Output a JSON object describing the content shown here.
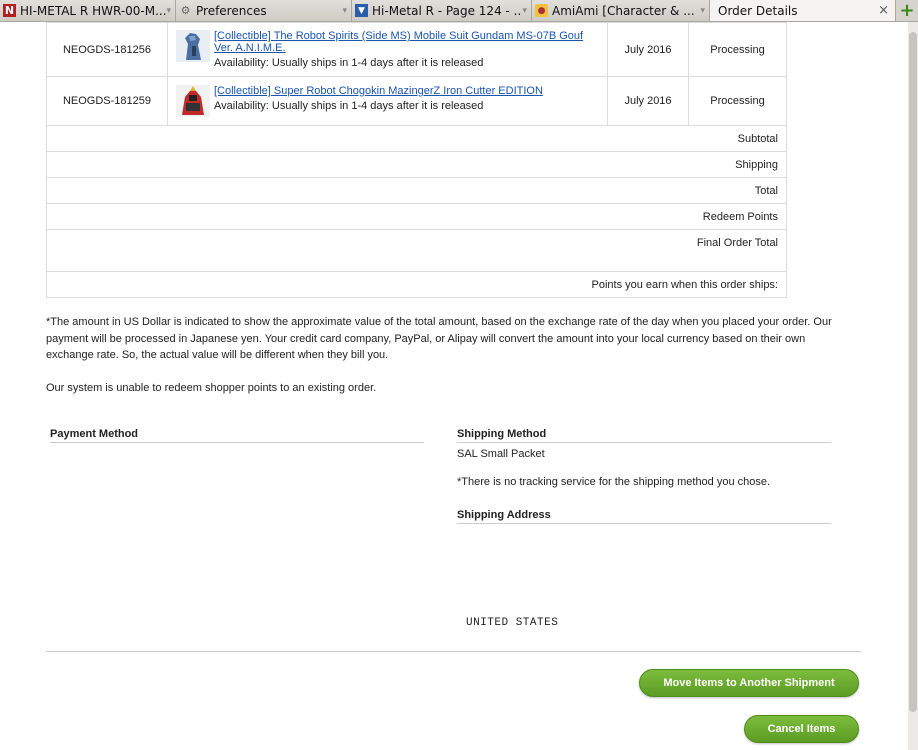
{
  "browser": {
    "tabs": [
      {
        "title": "HI-METAL R HWR-00-M...",
        "icon": "site-favicon"
      },
      {
        "title": "Preferences",
        "icon": "gear-icon"
      },
      {
        "title": "Hi-Metal R - Page 124 - ...",
        "icon": "site-favicon"
      },
      {
        "title": "AmiAmi [Character & ...",
        "icon": "site-favicon"
      },
      {
        "title": "Order Details",
        "icon": "",
        "active": true
      }
    ],
    "new_tab_label": "+"
  },
  "order_items": [
    {
      "code": "NEOGDS-181256",
      "name_line1": "[Collectible] The Robot Spirits (Side MS) Mobile Suit Gundam MS-07B Gouf",
      "name_line2": "Ver. A.N.I.M.E.",
      "availability": "Availability: Usually ships in 1-4 days after it is released",
      "release": "July 2016",
      "status": "Processing"
    },
    {
      "code": "NEOGDS-181259",
      "name_line1": "[Collectible] Super Robot Chogokin MazingerZ Iron Cutter EDITION",
      "name_line2": "",
      "availability": "Availability: Usually ships in 1-4 days after it is released",
      "release": "July 2016",
      "status": "Processing"
    }
  ],
  "summary": {
    "subtotal": "Subtotal",
    "shipping": "Shipping",
    "total": "Total",
    "redeem": "Redeem Points",
    "final": "Final Order Total",
    "points": "Points you earn when this order ships:"
  },
  "notes": {
    "currency": "*The amount in US Dollar is indicated to show the approximate value of the total amount, based on the exchange rate of the day when you placed your order. Our payment will be processed in Japanese yen. Your credit card company, PayPal, or Alipay will convert the amount into your local currency based on their own exchange rate. So, the actual value will be different when they bill you.",
    "redeem": "Our system is unable to redeem shopper points to an existing order."
  },
  "payment": {
    "heading": "Payment Method"
  },
  "shipping": {
    "heading": "Shipping Method",
    "method": "SAL Small Packet",
    "tracking_note": "*There is no tracking service for the shipping method you chose.",
    "address_heading": "Shipping Address",
    "country": "UNITED STATES"
  },
  "actions": {
    "move": "Move Items to Another Shipment",
    "cancel": "Cancel Items"
  },
  "colors": {
    "button_green": "#6aaa2e",
    "link": "#1a55b0"
  }
}
